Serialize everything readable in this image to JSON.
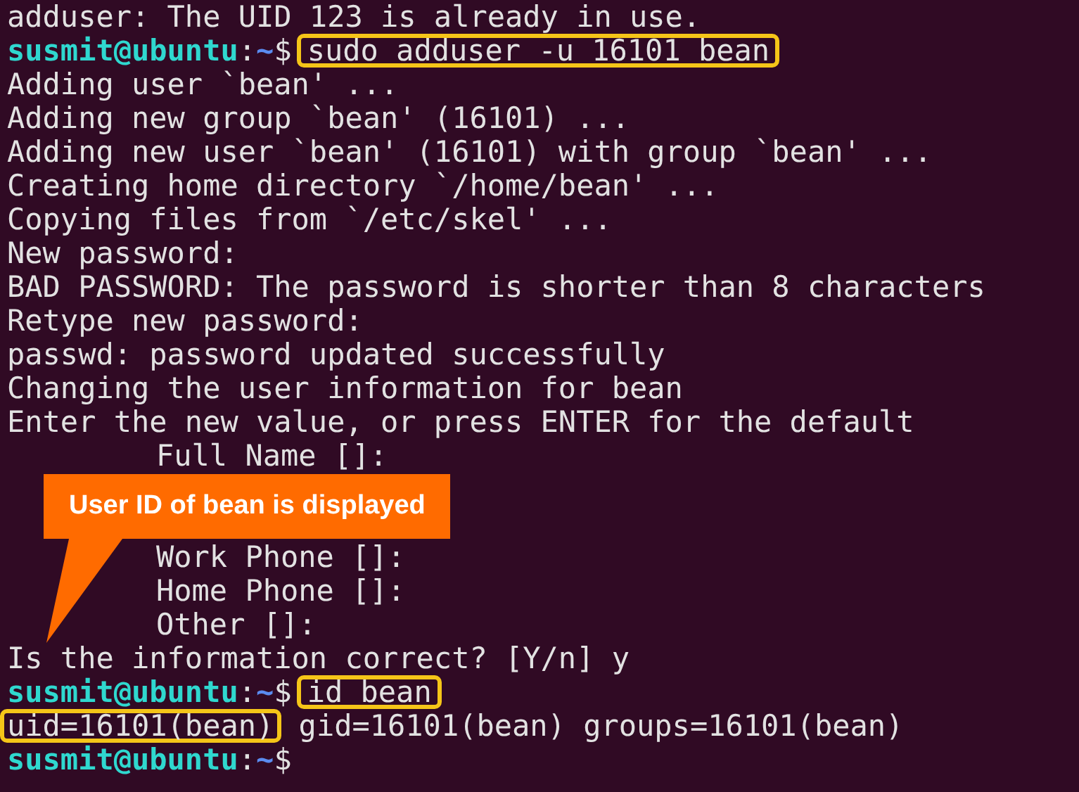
{
  "terminal": {
    "lines": [
      {
        "kind": "output",
        "indented": false,
        "segments": [
          {
            "text": "adduser: The UID 123 is already in use.",
            "highlighted": false
          }
        ]
      },
      {
        "kind": "prompt",
        "identity": "susmit@ubuntu",
        "sep": ":",
        "path": "~",
        "symbol": "$",
        "command": "sudo adduser -u 16101 bean",
        "highlighted": true
      },
      {
        "kind": "output",
        "indented": false,
        "segments": [
          {
            "text": "Adding user `bean' ...",
            "highlighted": false
          }
        ]
      },
      {
        "kind": "output",
        "indented": false,
        "segments": [
          {
            "text": "Adding new group `bean' (16101) ...",
            "highlighted": false
          }
        ]
      },
      {
        "kind": "output",
        "indented": false,
        "segments": [
          {
            "text": "Adding new user `bean' (16101) with group `bean' ...",
            "highlighted": false
          }
        ]
      },
      {
        "kind": "output",
        "indented": false,
        "segments": [
          {
            "text": "Creating home directory `/home/bean' ...",
            "highlighted": false
          }
        ]
      },
      {
        "kind": "output",
        "indented": false,
        "segments": [
          {
            "text": "Copying files from `/etc/skel' ...",
            "highlighted": false
          }
        ]
      },
      {
        "kind": "output",
        "indented": false,
        "segments": [
          {
            "text": "New password:",
            "highlighted": false
          }
        ]
      },
      {
        "kind": "output",
        "indented": false,
        "segments": [
          {
            "text": "BAD PASSWORD: The password is shorter than 8 characters",
            "highlighted": false
          }
        ]
      },
      {
        "kind": "output",
        "indented": false,
        "segments": [
          {
            "text": "Retype new password:",
            "highlighted": false
          }
        ]
      },
      {
        "kind": "output",
        "indented": false,
        "segments": [
          {
            "text": "passwd: password updated successfully",
            "highlighted": false
          }
        ]
      },
      {
        "kind": "output",
        "indented": false,
        "segments": [
          {
            "text": "Changing the user information for bean",
            "highlighted": false
          }
        ]
      },
      {
        "kind": "output",
        "indented": false,
        "segments": [
          {
            "text": "Enter the new value, or press ENTER for the default",
            "highlighted": false
          }
        ]
      },
      {
        "kind": "output",
        "indented": true,
        "segments": [
          {
            "text": "Full Name []:",
            "highlighted": false
          }
        ]
      },
      {
        "kind": "callout",
        "text": "User ID of bean is displayed"
      },
      {
        "kind": "output",
        "indented": true,
        "segments": [
          {
            "text": "Work Phone []:",
            "highlighted": false
          }
        ]
      },
      {
        "kind": "output",
        "indented": true,
        "segments": [
          {
            "text": "Home Phone []:",
            "highlighted": false
          }
        ]
      },
      {
        "kind": "output",
        "indented": true,
        "segments": [
          {
            "text": "Other []:",
            "highlighted": false
          }
        ]
      },
      {
        "kind": "output",
        "indented": false,
        "segments": [
          {
            "text": "Is the information correct? [Y/n] y",
            "highlighted": false
          }
        ]
      },
      {
        "kind": "prompt",
        "identity": "susmit@ubuntu",
        "sep": ":",
        "path": "~",
        "symbol": "$",
        "command": "id bean",
        "highlighted": true
      },
      {
        "kind": "output",
        "indented": false,
        "segments": [
          {
            "text": "uid=16101(bean)",
            "highlighted": true
          },
          {
            "text": " gid=16101(bean) groups=16101(bean)",
            "highlighted": false
          }
        ]
      },
      {
        "kind": "prompt",
        "identity": "susmit@ubuntu",
        "sep": ":",
        "path": "~",
        "symbol": "$"
      }
    ]
  }
}
